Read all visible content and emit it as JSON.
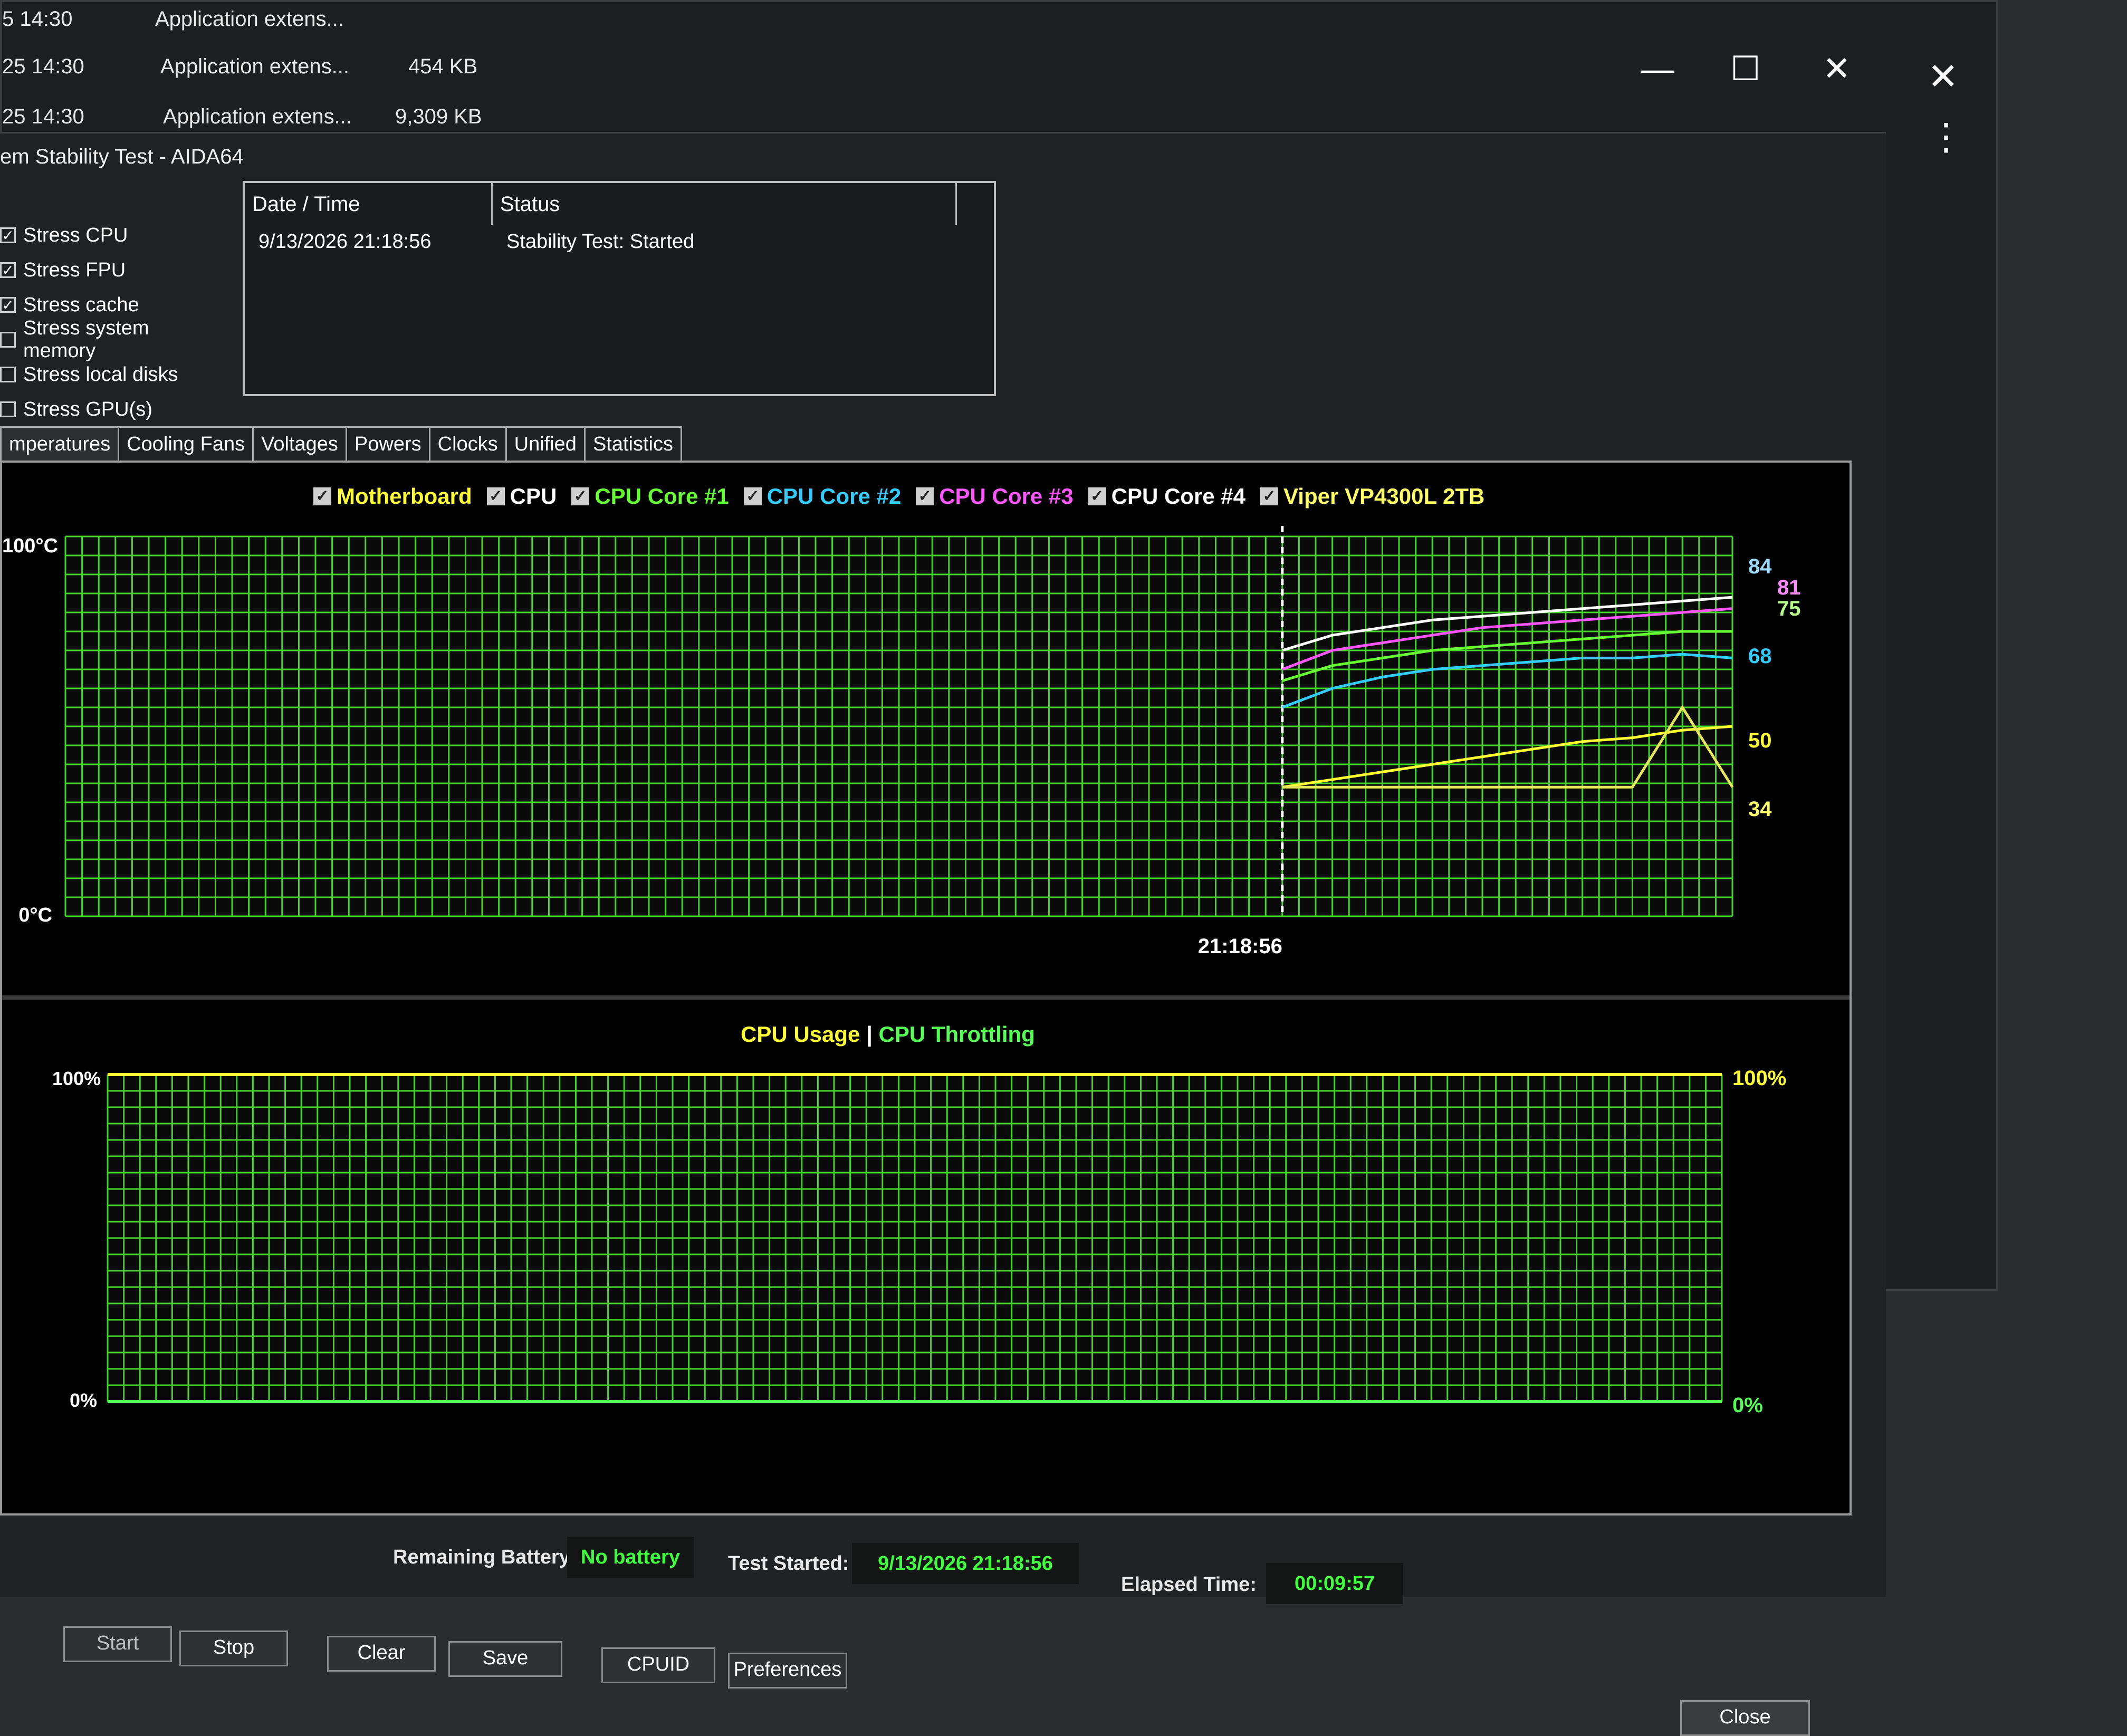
{
  "background_files": [
    {
      "time": "5 14:30",
      "type": "Application extens...",
      "size": ""
    },
    {
      "time": "25 14:30",
      "type": "Application extens...",
      "size": "454 KB"
    },
    {
      "time": "25 14:30",
      "type": "Application extens...",
      "size": "9,309 KB"
    }
  ],
  "window": {
    "title": "em Stability Test - AIDA64",
    "minimize": "—",
    "maximize": "☐",
    "close": "✕",
    "bg_close": "✕",
    "bg_menu": "⋮"
  },
  "stress_options": [
    {
      "label": "Stress CPU",
      "checked": true
    },
    {
      "label": "Stress FPU",
      "checked": true
    },
    {
      "label": "Stress cache",
      "checked": true
    },
    {
      "label": "Stress system memory",
      "checked": false
    },
    {
      "label": "Stress local disks",
      "checked": false
    },
    {
      "label": "Stress GPU(s)",
      "checked": false
    }
  ],
  "log": {
    "headers": [
      "Date / Time",
      "Status"
    ],
    "rows": [
      {
        "datetime": "9/13/2026 21:18:56",
        "status": "Stability Test: Started"
      }
    ]
  },
  "tabs": [
    "mperatures",
    "Cooling Fans",
    "Voltages",
    "Powers",
    "Clocks",
    "Unified",
    "Statistics"
  ],
  "temp_legend": [
    {
      "label": "Motherboard",
      "color": "#ffff33"
    },
    {
      "label": "CPU",
      "color": "#ffffff"
    },
    {
      "label": "CPU Core #1",
      "color": "#66ff33"
    },
    {
      "label": "CPU Core #2",
      "color": "#33ccff"
    },
    {
      "label": "CPU Core #3",
      "color": "#ff55ff"
    },
    {
      "label": "CPU Core #4",
      "color": "#ffffff"
    },
    {
      "label": "Viper VP4300L 2TB",
      "color": "#ffff66"
    }
  ],
  "temp_chart": {
    "y_top_label": "100°C",
    "y_bottom_label": "0°C",
    "time_marker": "21:18:56",
    "end_values": [
      "84",
      "81",
      "75",
      "68",
      "50",
      "34"
    ]
  },
  "usage_chart": {
    "title_a": "CPU Usage",
    "separator": "|",
    "title_b": "CPU Throttling",
    "left_top": "100%",
    "left_bottom": "0%",
    "right_top": "100%",
    "right_bottom": "0%"
  },
  "footer": {
    "remaining_battery_label": "Remaining Battery:",
    "remaining_battery_value": "No battery",
    "test_started_label": "Test Started:",
    "test_started_value": "9/13/2026 21:18:56",
    "elapsed_label": "Elapsed Time:",
    "elapsed_value": "00:09:57",
    "buttons": {
      "start": "Start",
      "stop": "Stop",
      "clear": "Clear",
      "save": "Save",
      "cpuid": "CPUID",
      "preferences": "Preferences",
      "close": "Close"
    }
  },
  "chart_data": [
    {
      "type": "line",
      "title": "",
      "ylabel": "",
      "ylim": [
        0,
        100
      ],
      "grid": true,
      "x_marker": "21:18:56",
      "series": [
        {
          "name": "CPU",
          "values": [
            70,
            74,
            76,
            78,
            79,
            80,
            81,
            82,
            83,
            84
          ]
        },
        {
          "name": "CPU Core #1",
          "values": [
            62,
            66,
            68,
            70,
            71,
            72,
            73,
            74,
            75,
            75
          ]
        },
        {
          "name": "CPU Core #2",
          "values": [
            55,
            60,
            63,
            65,
            66,
            67,
            68,
            68,
            69,
            68
          ]
        },
        {
          "name": "CPU Core #3",
          "values": [
            65,
            70,
            72,
            74,
            76,
            77,
            78,
            79,
            80,
            81
          ]
        },
        {
          "name": "Motherboard",
          "values": [
            34,
            36,
            38,
            40,
            42,
            44,
            46,
            47,
            49,
            50
          ]
        },
        {
          "name": "Viper VP4300L 2TB",
          "values": [
            34,
            34,
            34,
            34,
            34,
            34,
            34,
            34,
            55,
            34
          ]
        }
      ]
    },
    {
      "type": "line",
      "title": "",
      "ylim": [
        0,
        100
      ],
      "grid": true,
      "series": [
        {
          "name": "CPU Usage",
          "values": [
            100,
            100,
            100,
            100,
            100,
            100,
            100,
            100,
            100,
            100
          ]
        },
        {
          "name": "CPU Throttling",
          "values": [
            0,
            0,
            0,
            0,
            0,
            0,
            0,
            0,
            0,
            0
          ]
        }
      ]
    }
  ]
}
